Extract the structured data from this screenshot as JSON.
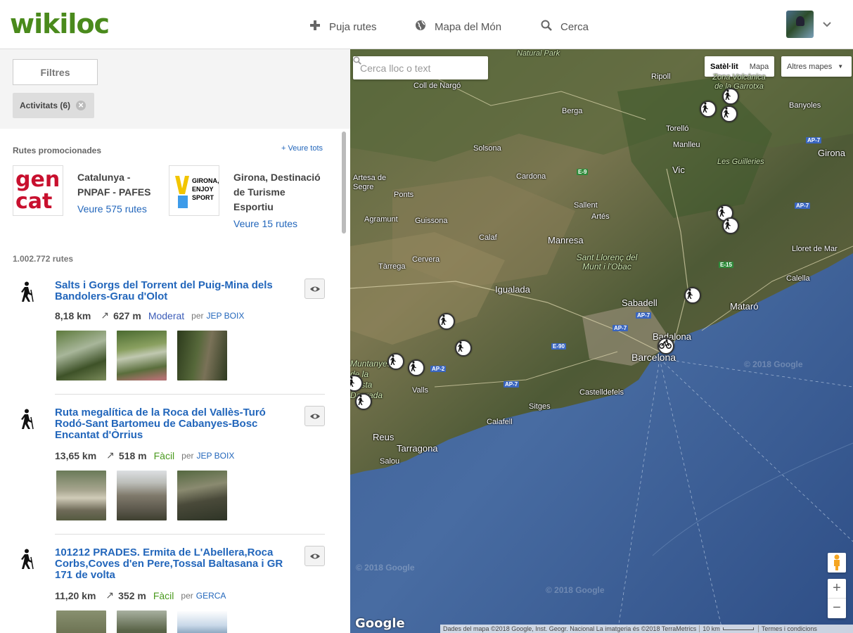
{
  "header": {
    "logo": "wikiloc",
    "nav": [
      {
        "icon": "plus-icon",
        "label": "Puja rutes"
      },
      {
        "icon": "globe-icon",
        "label": "Mapa del Món"
      },
      {
        "icon": "search-icon",
        "label": "Cerca"
      }
    ]
  },
  "filters": {
    "button": "Filtres",
    "chip": "Activitats (6)"
  },
  "promo": {
    "title": "Rutes promocionades",
    "see_all": "+ Veure tots",
    "items": [
      {
        "logo_text": "gen cat",
        "name": "Catalunya - PNPAF - PAFES",
        "link": "Veure 575 rutes"
      },
      {
        "logo_text": "GIRONA, ENJOY SPORT",
        "name": "Girona, Destinació de Turisme Esportiu",
        "link": "Veure 15 rutes"
      }
    ]
  },
  "count": "1.002.772 rutes",
  "routes": [
    {
      "title": "Salts i Gorgs del Torrent del Puig-Mina dels Bandolers-Grau d'Olot",
      "distance": "8,18 km",
      "elevation": "627 m",
      "level": "Moderat",
      "level_color": "#3b5cb8",
      "per": "per",
      "author": "JEP BOIX"
    },
    {
      "title": "Ruta megalítica de la Roca del Vallès-Turó Rodó-Sant Bartomeu de Cabanyes-Bosc Encantat d'Òrrius",
      "distance": "13,65 km",
      "elevation": "518 m",
      "level": "Fàcil",
      "level_color": "#4a9a1e",
      "per": "per",
      "author": "JEP BOIX"
    },
    {
      "title": "101212 PRADES. Ermita de L'Abellera,Roca Corbs,Coves d'en Pere,Tossal Baltasana i GR 171 de volta",
      "distance": "11,20 km",
      "elevation": "352 m",
      "level": "Fàcil",
      "level_color": "#4a9a1e",
      "per": "per",
      "author": "GERCA"
    }
  ],
  "map": {
    "search_placeholder": "Cerca lloc o text",
    "type_satellite": "Satèl·lit",
    "type_map": "Mapa",
    "other_maps": "Altres mapes",
    "google": "Google",
    "attribution": "Dades del mapa ©2018 Google, Inst. Geogr. Nacional La imatgeria és ©2018 TerraMetrics",
    "scale": "10 km",
    "terms": "Termes i condicions",
    "copyright": "© 2018 Google",
    "labels": {
      "natural_park": "Natural Park",
      "coll_de_nargo": "Coll de Nargó",
      "ripoll": "Ripoll",
      "zona_volcanica": "Zona Volcànica de la Garrotxa",
      "banyoles": "Banyoles",
      "berga": "Berga",
      "torello": "Torelló",
      "manlleu": "Manlleu",
      "solsona": "Solsona",
      "girona": "Girona",
      "les_guilleries": "Les Guilleries",
      "vic": "Vic",
      "artesa": "Artesa de Segre",
      "ponts": "Ponts",
      "cardona": "Cardona",
      "sallent": "Sallent",
      "artes": "Artés",
      "agramunt": "Agramunt",
      "guissona": "Guissona",
      "calaf": "Calaf",
      "manresa": "Manresa",
      "sant_llorenc": "Sant Llorenç del Munt i l'Obac",
      "lloret": "Lloret de Mar",
      "tarrega": "Tàrrega",
      "cervera": "Cervera",
      "calella": "Calella",
      "igualada": "Igualada",
      "sabadell": "Sabadell",
      "mataro": "Mataró",
      "badalona": "Badalona",
      "barcelona": "Barcelona",
      "muntanyes": "Muntanyes de la Costa Daurada",
      "valls": "Valls",
      "castelldefels": "Castelldefels",
      "sitges": "Sitges",
      "calafell": "Calafell",
      "reus": "Reus",
      "tarragona": "Tarragona",
      "salou": "Salou"
    },
    "roads": {
      "e9": "E-9",
      "ap7a": "AP-7",
      "ap7b": "AP-7",
      "e15": "E-15",
      "ap7c": "AP-7",
      "ap7d": "AP-7",
      "e90": "E-90",
      "ap2": "AP-2",
      "ap7e": "AP-7"
    }
  }
}
